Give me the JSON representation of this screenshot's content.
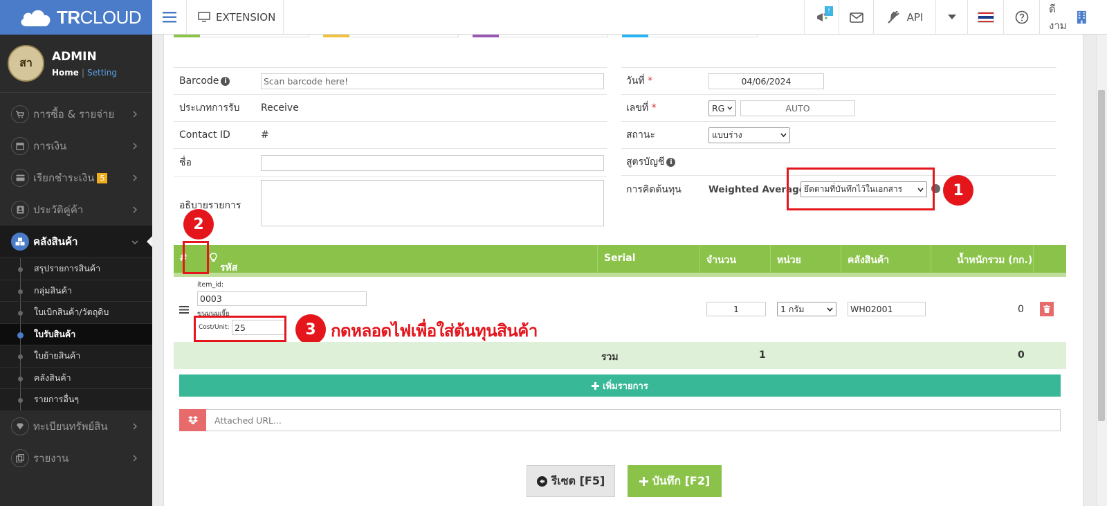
{
  "app": {
    "brand_bold": "TR",
    "brand_rest": "CLOUD",
    "extension_label": "EXTENSION",
    "notif_badge": "!",
    "api_label": "API",
    "user_label": "ดีงาม"
  },
  "profile": {
    "avatar_text": "สา",
    "name": "ADMIN",
    "home": "Home",
    "separator": "|",
    "setting": "Setting"
  },
  "sidebar": {
    "items": [
      {
        "label": "การซื้อ & รายจ่าย",
        "icon": "cart-icon"
      },
      {
        "label": "การเงิน",
        "icon": "calendar-icon"
      },
      {
        "label": "เรียกชำระเงิน",
        "icon": "card-icon",
        "badge": "5"
      },
      {
        "label": "ประวัติคู่ค้า",
        "icon": "contact-icon"
      },
      {
        "label": "คลังสินค้า",
        "icon": "boxes-icon"
      },
      {
        "label": "ทะเบียนทรัพย์สิน",
        "icon": "diamond-icon"
      },
      {
        "label": "รายงาน",
        "icon": "report-icon"
      }
    ],
    "sub_items": [
      "สรุปรายการสินค้า",
      "กลุ่มสินค้า",
      "ใบเบิกสินค้า/วัตถุดิบ",
      "ใบรับสินค้า",
      "ใบย้ายสินค้า",
      "คลังสินค้า",
      "รายการอื่นๆ"
    ]
  },
  "form_left": {
    "barcode_label": "Barcode",
    "barcode_placeholder": "Scan barcode here!",
    "type_label": "ประเภทการรับ",
    "type_value": "Receive",
    "contact_label": "Contact ID",
    "contact_value": "#",
    "name_label": "ชื่อ",
    "desc_label": "อธิบายรายการ"
  },
  "form_right": {
    "date_label": "วันที่",
    "date_value": "04/06/2024",
    "number_label": "เลขที่",
    "number_prefix": "RG",
    "number_value": "AUTO",
    "status_label": "สถานะ",
    "status_value": "แบบร่าง",
    "formula_label": "สูตรบัญชี",
    "cost_label": "การคิดต้นทุน",
    "cost_method": "Weighted Average",
    "cost_sep": "|",
    "cost_select": "ยึดตามที่บันทึกไว้ในเอกสาร"
  },
  "required_mark": "*",
  "grid": {
    "col_index": "#",
    "col_code": "รหัสสินค้า",
    "col_serial": "Serial",
    "col_qty": "จำนวน",
    "col_unit": "หน่วย",
    "col_warehouse": "คลังสินค้า",
    "col_weight": "น้ำหนักรวม (กก.)",
    "row": {
      "item_id_label": "item_id:",
      "item_id": "0003",
      "name_partial": "ขนมนมเจี๊ย",
      "cost_label": "Cost/Unit:",
      "cost_value": "25",
      "qty": "1",
      "unit": "1 กรัม",
      "warehouse": "WH02001",
      "weight": "0"
    },
    "total_label": "รวม",
    "total_qty": "1",
    "total_weight": "0"
  },
  "actions": {
    "add_row": "เพิ่มรายการ",
    "attach_placeholder": "Attached URL...",
    "reset": "รีเซต [F5]",
    "save": "บันทึก [F2]"
  },
  "annotations": {
    "marker1": "1",
    "marker2": "2",
    "marker3": "3",
    "instruction": "กดหลอดไฟเพื่อใส่ต้นทุนสินค้า"
  },
  "colors": {
    "brand": "#4a7cc9",
    "header_green": "#8bc34a",
    "add_button": "#38b897",
    "annotation_red": "#e4151b"
  }
}
